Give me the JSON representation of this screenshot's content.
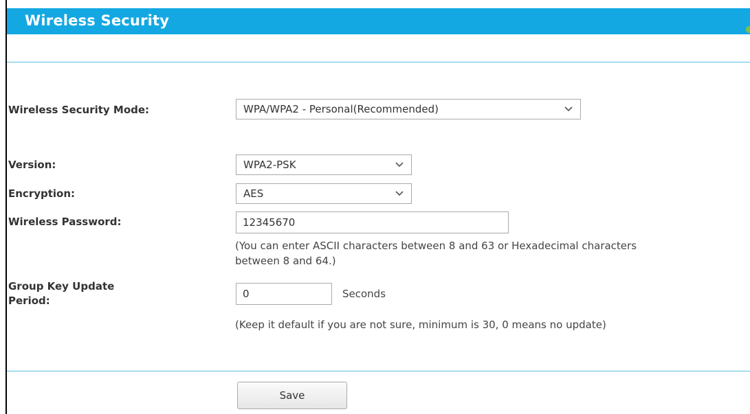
{
  "header": {
    "title": "Wireless Security",
    "title_bar_color": "#13a8e2"
  },
  "form": {
    "security_mode": {
      "label": "Wireless Security Mode:",
      "value": "WPA/WPA2 - Personal(Recommended)"
    },
    "version": {
      "label": "Version:",
      "value": "WPA2-PSK"
    },
    "encryption": {
      "label": "Encryption:",
      "value": "AES"
    },
    "password": {
      "label": "Wireless Password:",
      "value": "12345670",
      "hint_line1": "(You can enter ASCII characters between 8 and 63 or Hexadecimal characters",
      "hint_line2": "between 8 and 64.)"
    },
    "group_key": {
      "label_line1": "Group Key Update",
      "label_line2": "Period:",
      "value": "0",
      "unit": "Seconds",
      "hint": "(Keep it default if you are not sure, minimum is 30, 0 means no update)"
    }
  },
  "actions": {
    "save_label": "Save"
  },
  "icons": {
    "dropdown": "chevron-down-icon"
  }
}
